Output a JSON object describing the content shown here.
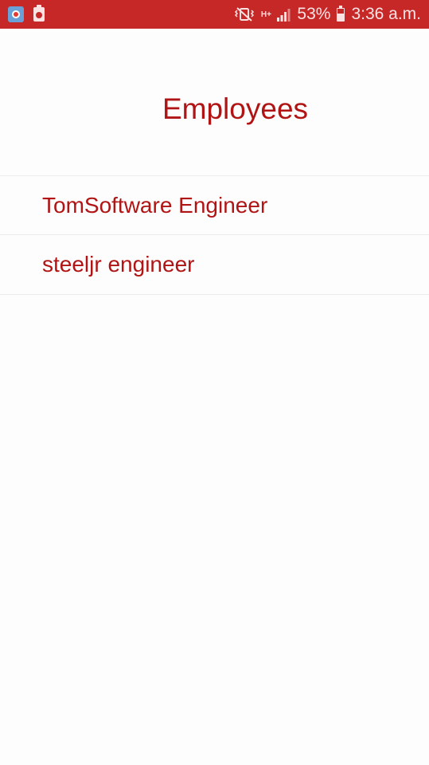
{
  "status_bar": {
    "left_icons": [
      "app-notification-icon",
      "clipboard-icon"
    ],
    "right_icons": [
      "vibrate-mute-icon",
      "hplus-network-icon",
      "signal-icon",
      "battery-icon"
    ],
    "network_type": "H+",
    "battery_percent": "53%",
    "time": "3:36 a.m.",
    "background_color": "#c62828"
  },
  "header": {
    "title": "Employees"
  },
  "employees": [
    {
      "name": "Tom",
      "role": "Software Engineer"
    },
    {
      "name": "steeljr",
      "role": " engineer"
    }
  ],
  "theme": {
    "accent_color": "#b01414"
  }
}
